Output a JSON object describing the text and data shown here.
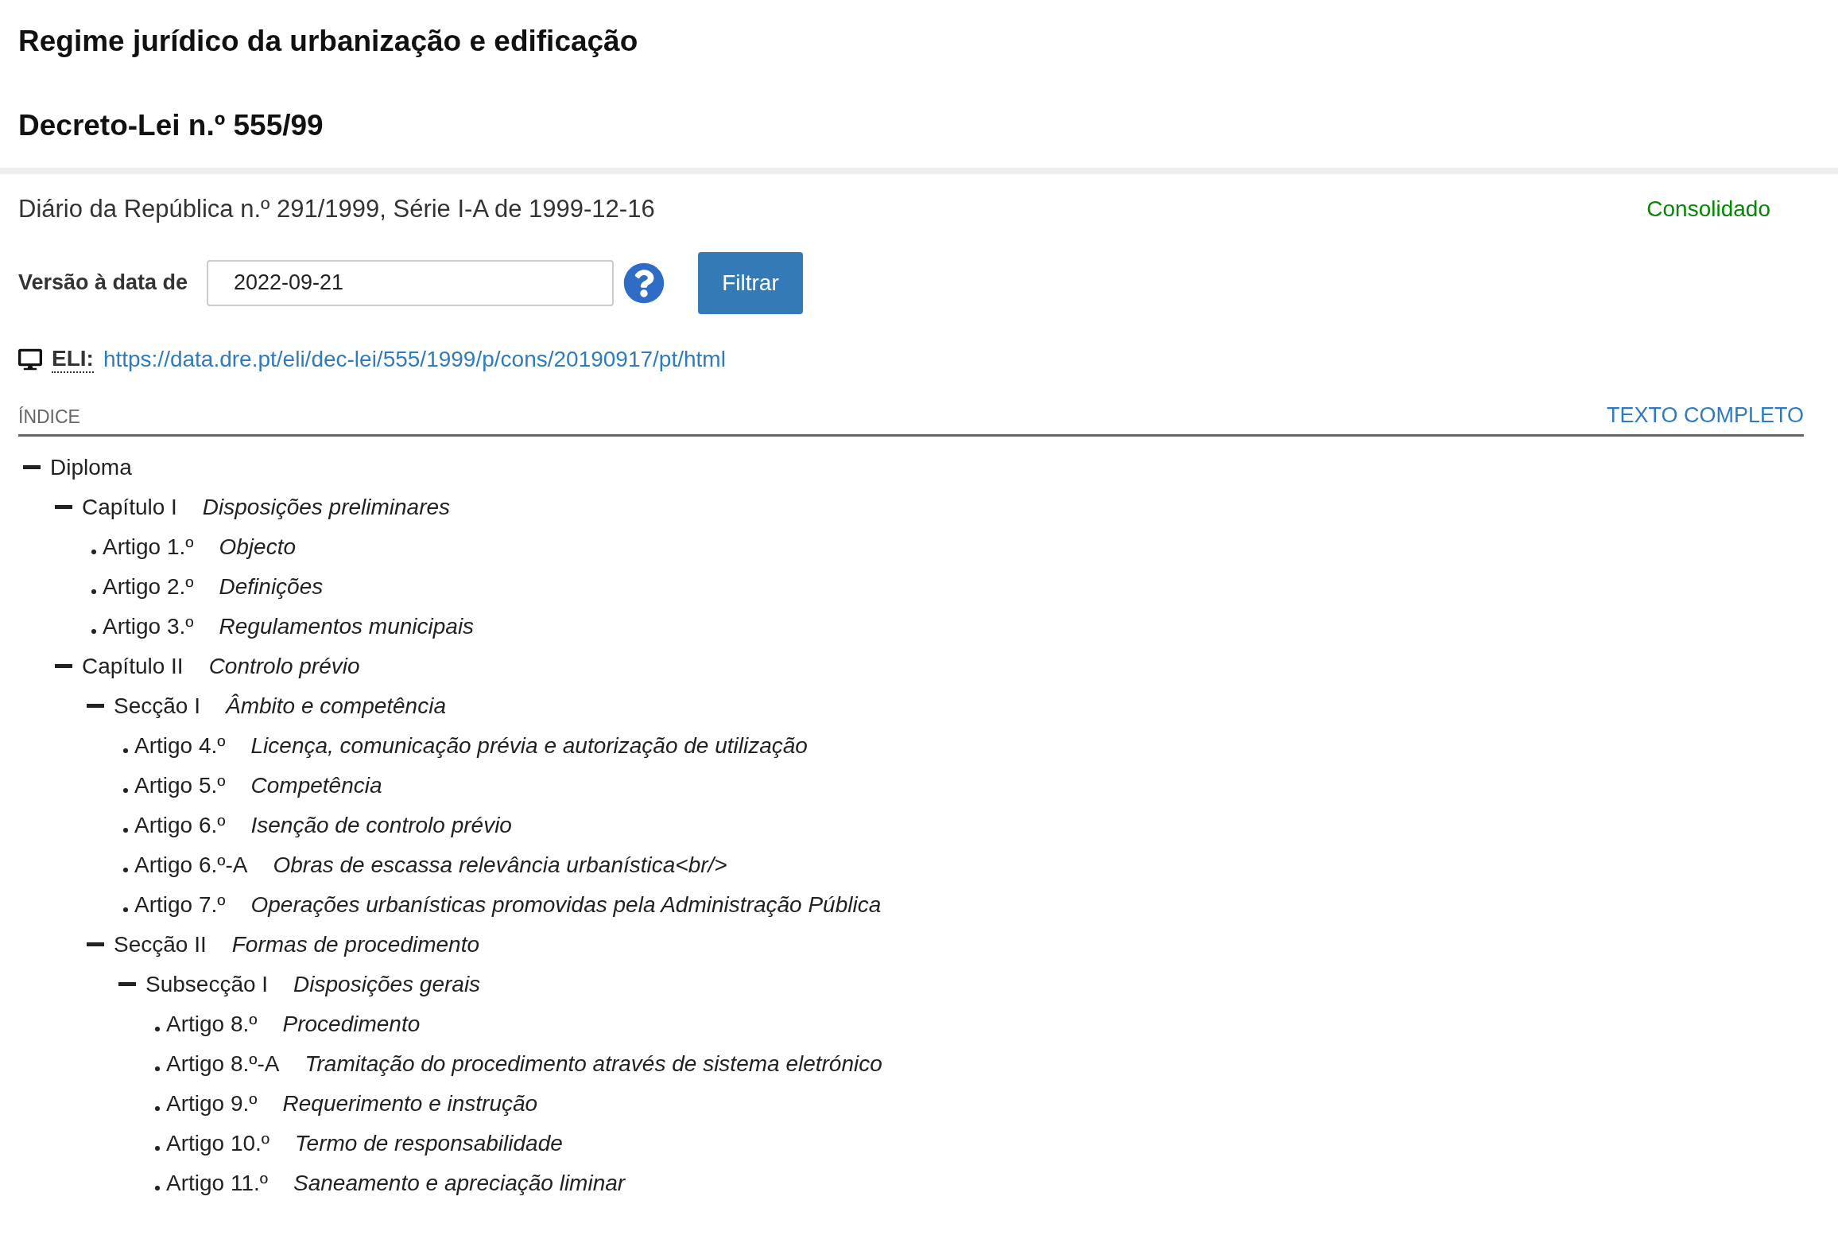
{
  "header": {
    "title": "Regime jurídico da urbanização e edificação",
    "subtitle": "Decreto-Lei n.º 555/99"
  },
  "publication": {
    "text": "Diário da República n.º 291/1999, Série I-A de 1999-12-16",
    "status": "Consolidado"
  },
  "version_filter": {
    "label": "Versão à data de",
    "value": "2022-09-21",
    "button": "Filtrar"
  },
  "eli": {
    "label": "ELI:",
    "url": "https://data.dre.pt/eli/dec-lei/555/1999/p/cons/20190917/pt/html"
  },
  "index": {
    "heading": "ÍNDICE",
    "full_text_link": "TEXTO COMPLETO",
    "tree": [
      {
        "label": "Diploma",
        "expanded": true,
        "children": [
          {
            "label": "Capítulo I",
            "title": "Disposições preliminares",
            "expanded": true,
            "children": [
              {
                "label": "Artigo 1.º",
                "title": "Objecto"
              },
              {
                "label": "Artigo 2.º",
                "title": "Definições"
              },
              {
                "label": "Artigo 3.º",
                "title": "Regulamentos municipais"
              }
            ]
          },
          {
            "label": "Capítulo II",
            "title": "Controlo prévio",
            "expanded": true,
            "children": [
              {
                "label": "Secção I",
                "title": "Âmbito e competência",
                "expanded": true,
                "children": [
                  {
                    "label": "Artigo 4.º",
                    "title": "Licença, comunicação prévia e autorização de utilização"
                  },
                  {
                    "label": "Artigo 5.º",
                    "title": "Competência"
                  },
                  {
                    "label": "Artigo 6.º",
                    "title": "Isenção de controlo prévio"
                  },
                  {
                    "label": "Artigo 6.º-A",
                    "title": "Obras de escassa relevância urbanística<br/>"
                  },
                  {
                    "label": "Artigo 7.º",
                    "title": "Operações urbanísticas promovidas pela Administração Pública"
                  }
                ]
              },
              {
                "label": "Secção II",
                "title": "Formas de procedimento",
                "expanded": true,
                "children": [
                  {
                    "label": "Subsecção I",
                    "title": "Disposições gerais",
                    "expanded": true,
                    "children": [
                      {
                        "label": "Artigo 8.º",
                        "title": "Procedimento"
                      },
                      {
                        "label": "Artigo 8.º-A",
                        "title": "Tramitação do procedimento através de sistema eletrónico"
                      },
                      {
                        "label": "Artigo 9.º",
                        "title": "Requerimento e instrução"
                      },
                      {
                        "label": "Artigo 10.º",
                        "title": "Termo de responsabilidade"
                      },
                      {
                        "label": "Artigo 11.º",
                        "title": "Saneamento e apreciação liminar"
                      }
                    ]
                  }
                ]
              }
            ]
          }
        ]
      }
    ]
  }
}
